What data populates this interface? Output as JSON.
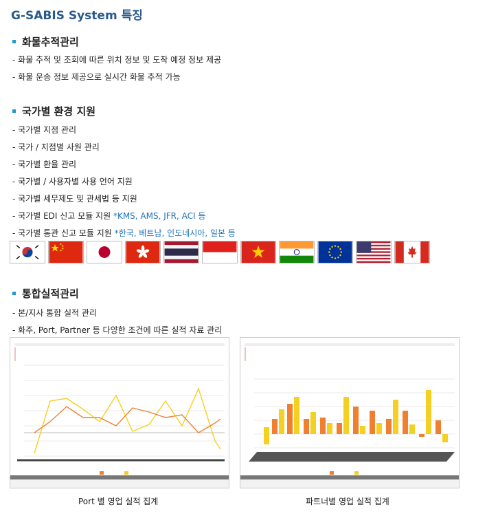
{
  "page_title": "G-SABIS System 특징",
  "sections": [
    {
      "heading": "화물추적관리",
      "lines": [
        {
          "text": "- 화물 추적 및 조회에 따른 위치 정보 및 도착 예정 정보 제공",
          "highlight": ""
        },
        {
          "text": "- 화물 운송 정보 제공으로 실시간 화물 추적 가능",
          "highlight": ""
        }
      ]
    },
    {
      "heading": "국가별 환경 지원",
      "lines": [
        {
          "text": "- 국가별 지점 관리",
          "highlight": ""
        },
        {
          "text": "- 국가 / 지점별 사원 관리",
          "highlight": ""
        },
        {
          "text": "- 국가별 환율 관리",
          "highlight": ""
        },
        {
          "text": "- 국가별 / 사용자별 사용 언어 지원",
          "highlight": ""
        },
        {
          "text": "- 국가별 세무제도 및 관세법 등 지원",
          "highlight": ""
        },
        {
          "text": "- 국가별 EDI 신고 모듈 지원 ",
          "highlight": "*KMS, AMS, JFR, ACI 등"
        },
        {
          "text": "- 국가별 통관 신고 모듈 지원 ",
          "highlight": "*한국, 베트남, 인도네시아, 일본 등"
        }
      ]
    },
    {
      "heading": "통합실적관리",
      "lines": [
        {
          "text": "- 본/지사 통합 실적 관리",
          "highlight": ""
        },
        {
          "text": "- 화주, Port, Partner 등 다양한 조건에 따른 실적 자료 관리",
          "highlight": ""
        }
      ]
    }
  ],
  "flags": [
    {
      "country": "korea-flag-icon"
    },
    {
      "country": "china-flag-icon"
    },
    {
      "country": "japan-flag-icon"
    },
    {
      "country": "hongkong-flag-icon"
    },
    {
      "country": "thailand-flag-icon"
    },
    {
      "country": "indonesia-flag-icon"
    },
    {
      "country": "vietnam-flag-icon"
    },
    {
      "country": "india-flag-icon"
    },
    {
      "country": "eu-flag-icon"
    },
    {
      "country": "usa-flag-icon"
    },
    {
      "country": "canada-flag-icon"
    }
  ],
  "captions": {
    "left": "Port 별 영업 실적 집계",
    "right": "파트너별 영업 실적 집계"
  },
  "colors": {
    "accent": "#1e9ad6",
    "title": "#2a5a8a",
    "highlight": "#1d72b8",
    "series_measurement": "#f08030",
    "series_profit": "#f5d020"
  }
}
